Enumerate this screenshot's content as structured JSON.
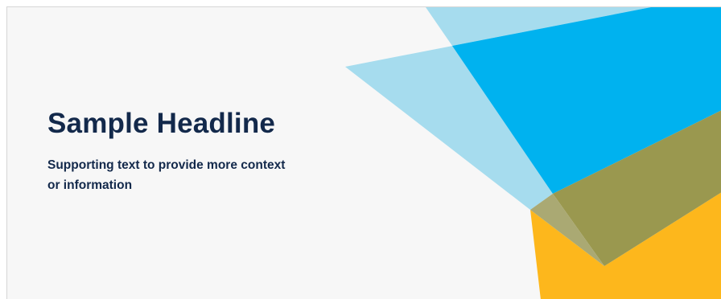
{
  "banner": {
    "headline": "Sample Headline",
    "supporting_text": "Supporting text to provide more context or information"
  },
  "colors": {
    "background": "#f7f7f7",
    "text": "#13294b",
    "light_blue": "#a6dcee",
    "bright_blue": "#00b2ef",
    "olive": "#9a984f",
    "yellow": "#fdb71c",
    "muted_olive": "#aaa973"
  }
}
